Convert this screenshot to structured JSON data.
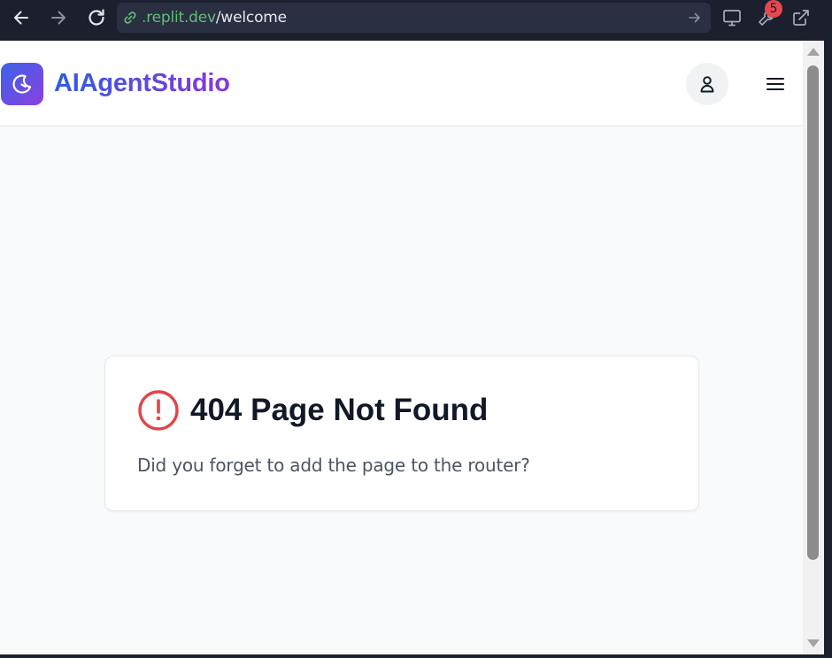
{
  "browser": {
    "url": {
      "domain": ".replit.dev",
      "path": "/welcome"
    },
    "icons": {
      "back": "arrow-left-icon",
      "forward": "arrow-right-icon",
      "reload": "reload-icon",
      "link": "link-icon",
      "go": "arrow-right-icon",
      "devices": "monitor-icon",
      "tools": "wrench-icon",
      "open_new": "external-link-icon"
    },
    "tools_badge": "5"
  },
  "app": {
    "brand": "AIAgentStudio",
    "logo_icon": "moon-icon",
    "user_icon": "user-icon",
    "menu_icon": "hamburger-menu-icon",
    "colors": {
      "brand_gradient_start": "#3b63e8",
      "brand_gradient_end": "#8b3fe0",
      "error": "#e24646"
    }
  },
  "error_card": {
    "icon": "alert-circle-icon",
    "title": "404 Page Not Found",
    "message": "Did you forget to add the page to the router?"
  }
}
